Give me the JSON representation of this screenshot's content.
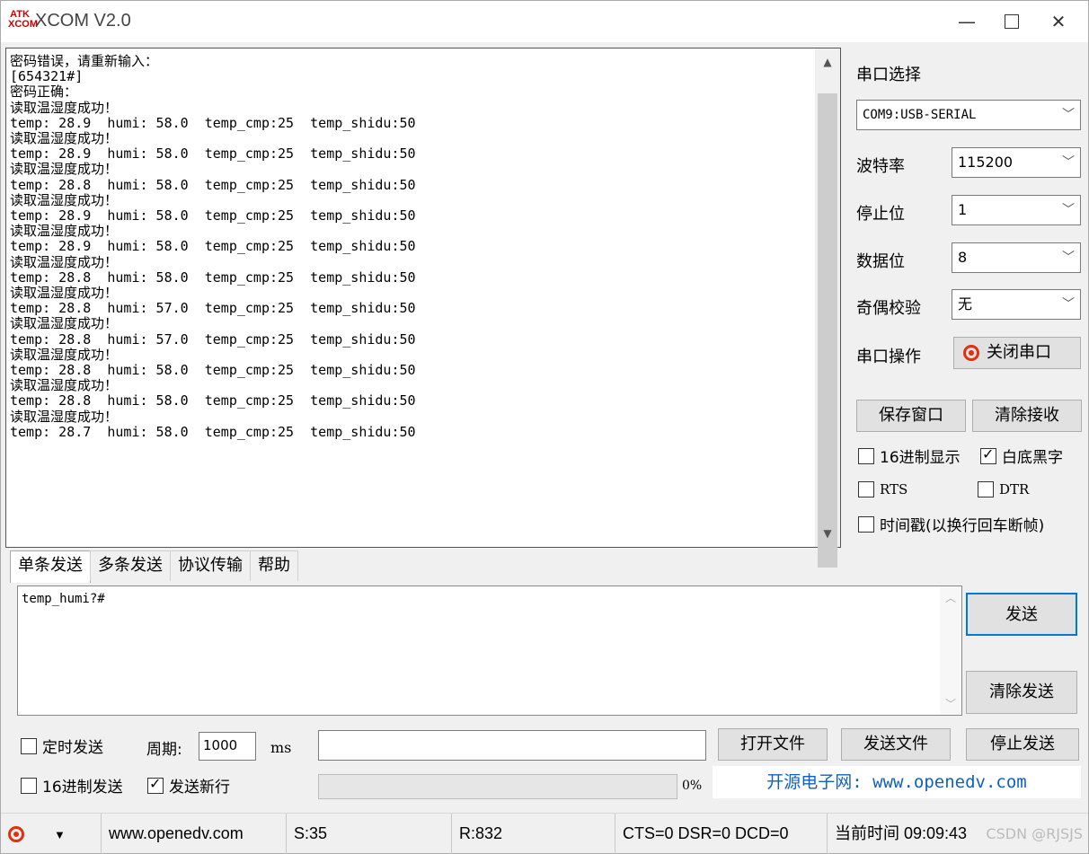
{
  "window": {
    "title": "XCOM V2.0",
    "logo_top": "ATK",
    "logo_bottom": "XCOM"
  },
  "receive": {
    "lines": [
      "密码错误，请重新输入：",
      "[654321#]",
      "密码正确：",
      "读取温湿度成功！",
      "temp: 28.9  humi: 58.0  temp_cmp:25  temp_shidu:50",
      "读取温湿度成功！",
      "temp: 28.9  humi: 58.0  temp_cmp:25  temp_shidu:50",
      "读取温湿度成功！",
      "temp: 28.8  humi: 58.0  temp_cmp:25  temp_shidu:50",
      "读取温湿度成功！",
      "temp: 28.9  humi: 58.0  temp_cmp:25  temp_shidu:50",
      "读取温湿度成功！",
      "temp: 28.9  humi: 58.0  temp_cmp:25  temp_shidu:50",
      "读取温湿度成功！",
      "temp: 28.8  humi: 58.0  temp_cmp:25  temp_shidu:50",
      "读取温湿度成功！",
      "temp: 28.8  humi: 57.0  temp_cmp:25  temp_shidu:50",
      "读取温湿度成功！",
      "temp: 28.8  humi: 57.0  temp_cmp:25  temp_shidu:50",
      "读取温湿度成功！",
      "temp: 28.8  humi: 58.0  temp_cmp:25  temp_shidu:50",
      "读取温湿度成功！",
      "temp: 28.8  humi: 58.0  temp_cmp:25  temp_shidu:50",
      "读取温湿度成功！",
      "temp: 28.7  humi: 58.0  temp_cmp:25  temp_shidu:50"
    ]
  },
  "panel": {
    "port_label": "串口选择",
    "port_value": "COM9:USB-SERIAL",
    "baud_label": "波特率",
    "baud_value": "115200",
    "stop_label": "停止位",
    "stop_value": "1",
    "data_label": "数据位",
    "data_value": "8",
    "parity_label": "奇偶校验",
    "parity_value": "无",
    "op_label": "串口操作",
    "close_port": "关闭串口",
    "save_window": "保存窗口",
    "clear_recv": "清除接收",
    "hex_display": "16进制显示",
    "white_black": "白底黑字",
    "rts": "RTS",
    "dtr": "DTR",
    "timestamp": "时间戳(以换行回车断帧)"
  },
  "tabs": [
    "单条发送",
    "多条发送",
    "协议传输",
    "帮助"
  ],
  "send": {
    "text": "temp_humi?#",
    "send_button": "发送",
    "clear_send": "清除发送",
    "timed_send": "定时发送",
    "period_label": "周期:",
    "period_value": "1000",
    "ms": "ms",
    "open_file": "打开文件",
    "send_file": "发送文件",
    "stop_send": "停止发送",
    "hex_send": "16进制发送",
    "new_line": "发送新行",
    "progress": "0%",
    "link": "开源电子网: www.openedv.com"
  },
  "status": {
    "url": "www.openedv.com",
    "sent": "S:35",
    "received": "R:832",
    "lines": "CTS=0 DSR=0 DCD=0",
    "time": "当前时间 09:09:43",
    "watermark": "CSDN @RJSJS"
  },
  "colors": {
    "accent": "#0078d7",
    "record": "#e03010",
    "link": "#1060c0"
  }
}
